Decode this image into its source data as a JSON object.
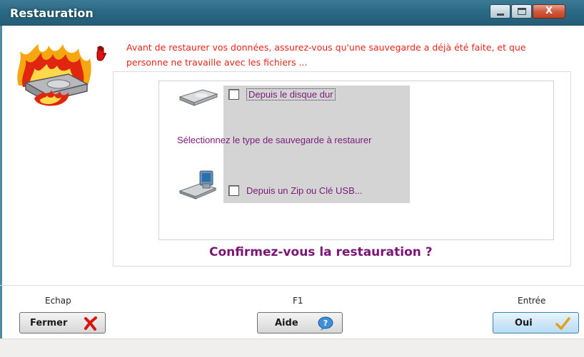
{
  "window": {
    "title": "Restauration",
    "controls": {
      "close_label": "X"
    }
  },
  "warning": {
    "text": "Avant de restaurer vos données, assurez-vous qu'une sauvegarde a déjà été faite, et que personne ne travaille avec les fichiers   ...",
    "color": "#e8241c"
  },
  "options": {
    "hard_disk": {
      "label": "Depuis le disque dur",
      "checked": false,
      "icon": "hard-drive-icon"
    },
    "select_text": "Sélectionnez le type de sauvegarde à restaurer",
    "usb": {
      "label": "Depuis un  Zip ou Clé USB...",
      "checked": false,
      "icon": "usb-drive-icon"
    }
  },
  "confirm_question": "Confirmez-vous la restauration  ?",
  "footer": {
    "buttons": [
      {
        "key": "Echap",
        "label": "Fermer",
        "icon": "red-x-icon"
      },
      {
        "key": "F1",
        "label": "Aide",
        "icon": "help-icon"
      },
      {
        "key": "Entrée",
        "label": "Oui",
        "icon": "checkmark-icon"
      }
    ]
  },
  "colors": {
    "titlebar": "#2b6a86",
    "label_purple": "#7b1a7a",
    "confirm_purple": "#7c1476",
    "warning_red": "#e8241c"
  }
}
